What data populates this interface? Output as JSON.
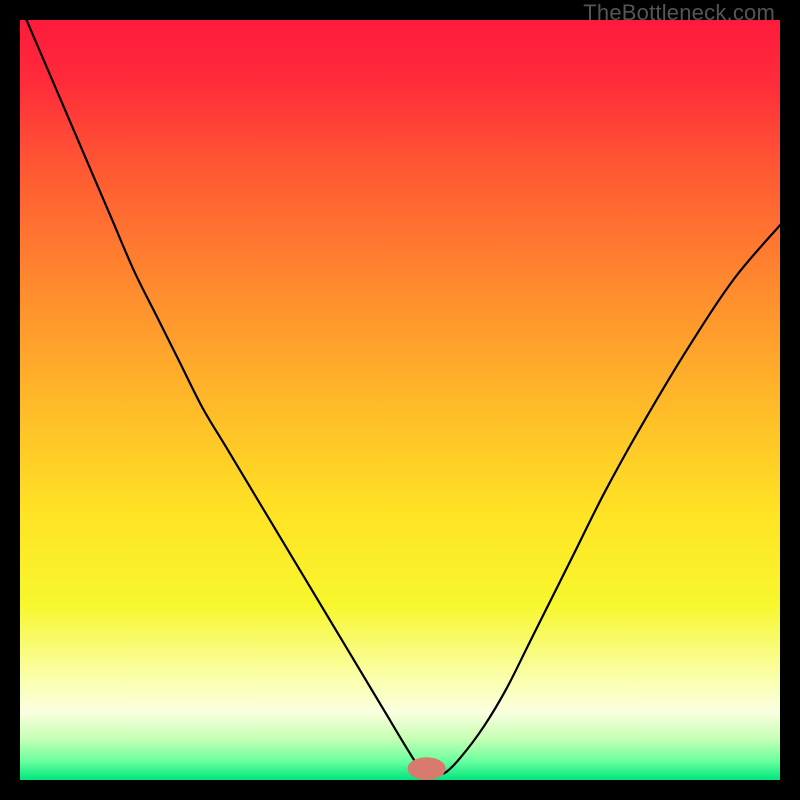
{
  "watermark": "TheBottleneck.com",
  "chart_data": {
    "type": "line",
    "title": "",
    "xlabel": "",
    "ylabel": "",
    "xlim": [
      0,
      100
    ],
    "ylim": [
      0,
      100
    ],
    "background_gradient": {
      "stops": [
        {
          "offset": 0.0,
          "color": "#ff1a3d"
        },
        {
          "offset": 0.08,
          "color": "#ff2b3a"
        },
        {
          "offset": 0.2,
          "color": "#ff5a33"
        },
        {
          "offset": 0.35,
          "color": "#ff8a2e"
        },
        {
          "offset": 0.5,
          "color": "#ffb829"
        },
        {
          "offset": 0.65,
          "color": "#ffe324"
        },
        {
          "offset": 0.77,
          "color": "#f7f72e"
        },
        {
          "offset": 0.87,
          "color": "#faffb0"
        },
        {
          "offset": 0.91,
          "color": "#fbffe0"
        },
        {
          "offset": 0.945,
          "color": "#c8ffb5"
        },
        {
          "offset": 0.975,
          "color": "#6bff9e"
        },
        {
          "offset": 1.0,
          "color": "#00e57e"
        }
      ]
    },
    "marker": {
      "x": 53.5,
      "y": 1.5,
      "color": "#d87a6d",
      "rx": 2.5,
      "ry": 1.5
    },
    "series": [
      {
        "name": "curve",
        "x": [
          0,
          3,
          6,
          9,
          12,
          15,
          18,
          21,
          24,
          27,
          30,
          33,
          36,
          39,
          42,
          45,
          48,
          51,
          53,
          54,
          55,
          56,
          58,
          61,
          64,
          67,
          70,
          73,
          77,
          82,
          88,
          94,
          100
        ],
        "values": [
          102,
          95,
          88,
          81,
          74,
          67,
          61,
          55,
          49,
          44,
          39,
          34,
          29,
          24,
          19,
          14,
          9,
          4,
          1,
          1,
          1,
          1,
          3,
          7,
          12,
          18,
          24,
          30,
          38,
          47,
          57,
          66,
          73
        ]
      }
    ]
  }
}
